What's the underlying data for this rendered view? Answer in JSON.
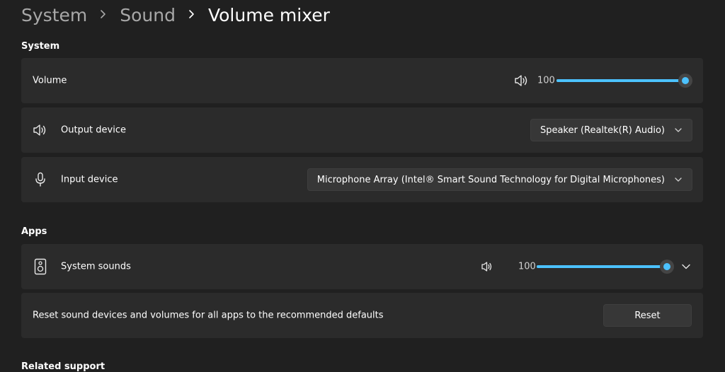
{
  "breadcrumb": {
    "items": [
      "System",
      "Sound"
    ],
    "current": "Volume mixer"
  },
  "sections": {
    "system": "System",
    "apps": "Apps",
    "related_support": "Related support"
  },
  "system": {
    "volume": {
      "label": "Volume",
      "value": "100",
      "level_percent": 100,
      "icon": "speaker-icon"
    },
    "output_device": {
      "label": "Output device",
      "selected": "Speaker (Realtek(R) Audio)",
      "icon": "speaker-icon"
    },
    "input_device": {
      "label": "Input device",
      "selected": "Microphone Array (Intel® Smart Sound Technology for Digital Microphones)",
      "icon": "microphone-icon"
    }
  },
  "apps": {
    "system_sounds": {
      "label": "System sounds",
      "value": "100",
      "level_percent": 100,
      "icon": "device-speaker-icon"
    }
  },
  "reset": {
    "text": "Reset sound devices and volumes for all apps to the recommended defaults",
    "button_label": "Reset"
  },
  "colors": {
    "background": "#202020",
    "card": "#2b2b2b",
    "accent": "#4cc2ff",
    "control": "#373737"
  }
}
